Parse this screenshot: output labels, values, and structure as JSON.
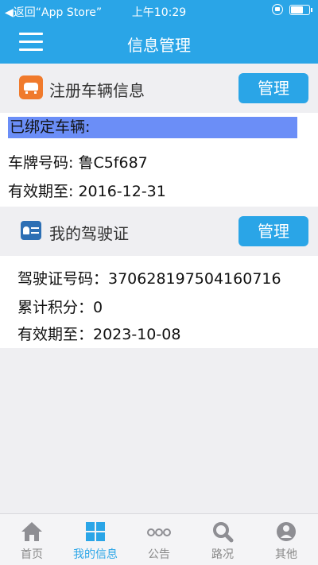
{
  "status": {
    "back": "◀返回“App Store”",
    "time": "上午10:29"
  },
  "nav": {
    "title": "信息管理"
  },
  "vehicle": {
    "section_title": "注册车辆信息",
    "manage_label": "管理",
    "bound_label": "已绑定车辆:",
    "plate": "车牌号码: 鲁C5f687",
    "expiry": "有效期至: 2016-12-31"
  },
  "license": {
    "section_title": "我的驾驶证",
    "manage_label": "管理",
    "number": "驾驶证号码：370628197504160716",
    "points": "累计积分：0",
    "expiry": "有效期至：2023-10-08"
  },
  "tabs": [
    {
      "label": "首页",
      "icon": "home-icon"
    },
    {
      "label": "我的信息",
      "icon": "grid-icon"
    },
    {
      "label": "公告",
      "icon": "dots-icon"
    },
    {
      "label": "路况",
      "icon": "search-icon"
    },
    {
      "label": "其他",
      "icon": "more-icon"
    }
  ],
  "colors": {
    "primary": "#2aa5e7",
    "highlight": "#6b8ef7",
    "car_icon": "#f07a2c",
    "license_icon": "#2d6fb4"
  }
}
